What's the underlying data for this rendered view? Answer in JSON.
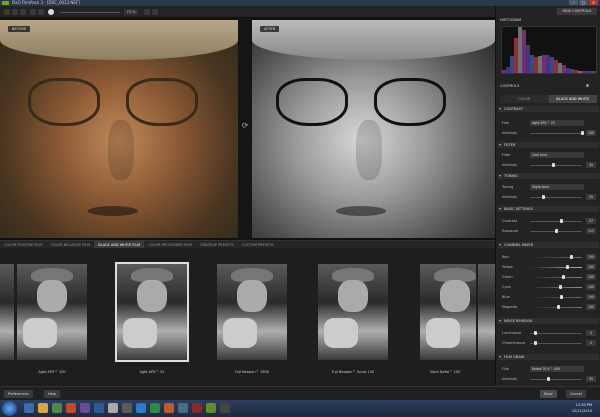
{
  "window": {
    "title": "DxO FilmPack 3 - [DSC_0012.NEF]",
    "controls": [
      "–",
      "□",
      "×"
    ]
  },
  "toolbar": {
    "zoom": "75 %"
  },
  "viewer": {
    "before_label": "BEFORE",
    "after_label": "AFTER"
  },
  "film_tabs": [
    {
      "label": "COLOR POSITIVE FILM",
      "active": false
    },
    {
      "label": "COLOR NEGATIVE FILM",
      "active": false
    },
    {
      "label": "BLACK AND WHITE FILM",
      "active": true
    },
    {
      "label": "COLOR PROCESSED FILM",
      "active": false
    },
    {
      "label": "CREATIVE PRESETS",
      "active": false
    },
    {
      "label": "CUSTOM PRESETS",
      "active": false
    }
  ],
  "thumbnails": [
    {
      "label": "Agfa APX™ 100",
      "selected": false
    },
    {
      "label": "Agfa APX™ 25",
      "selected": true
    },
    {
      "label": "Fuji Neopan™ 1600",
      "selected": false
    },
    {
      "label": "Fuji Neopan™ Acros 100",
      "selected": false
    },
    {
      "label": "Ilford Delta™ 100",
      "selected": false
    }
  ],
  "bottom": {
    "preferences": "Preferences",
    "help": "Help",
    "save": "Save",
    "cancel": "Cancel"
  },
  "panel": {
    "hide_controls": "HIDE CONTROLS",
    "histogram": "HISTOGRAM",
    "controls": "CONTROLS",
    "tabs": [
      {
        "label": "COLOR",
        "active": false
      },
      {
        "label": "BLACK AND WHITE",
        "active": true
      }
    ],
    "film": {
      "title": "CONTRAST",
      "film_label": "Film",
      "film_value": "Agfa APX™ 25",
      "intensity_label": "Intensity",
      "intensity_value": "100",
      "intensity_pct": 100
    },
    "filter": {
      "title": "FILTER",
      "filter_label": "Filter",
      "filter_value": "Cool tone",
      "intensity_label": "Intensity",
      "intensity_value": "45",
      "intensity_pct": 45
    },
    "toning": {
      "title": "TONING",
      "toning_label": "Toning",
      "toning_value": "Sepia tone",
      "intensity_label": "Intensity",
      "intensity_value": "25",
      "intensity_pct": 25
    },
    "basic": {
      "title": "BASIC SETTINGS",
      "rows": [
        {
          "label": "Contrast",
          "value": "27",
          "pct": 60
        },
        {
          "label": "Exposure",
          "value": "0.0",
          "pct": 50
        }
      ]
    },
    "channel": {
      "title": "CHANNEL MIXER",
      "rows": [
        {
          "label": "Red",
          "value": "100",
          "pct": 80,
          "color": "#d04040"
        },
        {
          "label": "Yellow",
          "value": "100",
          "pct": 72,
          "color": "#d0c040"
        },
        {
          "label": "Green",
          "value": "100",
          "pct": 65,
          "color": "#40b040"
        },
        {
          "label": "Cyan",
          "value": "100",
          "pct": 58,
          "color": "#40b0c0"
        },
        {
          "label": "Blue",
          "value": "100",
          "pct": 60,
          "color": "#4060d0"
        },
        {
          "label": "Magenta",
          "value": "100",
          "pct": 55,
          "color": "#c040c0"
        }
      ]
    },
    "noise": {
      "title": "NOISE REMOVAL",
      "rows": [
        {
          "label": "Luminance",
          "value": "0",
          "pct": 10
        },
        {
          "label": "Chrominance",
          "value": "0",
          "pct": 10
        }
      ]
    },
    "grain": {
      "title": "FILM GRAIN",
      "film_label": "Film",
      "film_value": "Kodak Tri-X™ 400",
      "intensity_label": "Intensity",
      "intensity_value": "35",
      "intensity_pct": 35
    }
  },
  "clock": {
    "time": "12:30 PM",
    "date": "12/11/2010"
  },
  "colors": {
    "accent": "#3a3a3a",
    "panel_bg": "#232323"
  }
}
